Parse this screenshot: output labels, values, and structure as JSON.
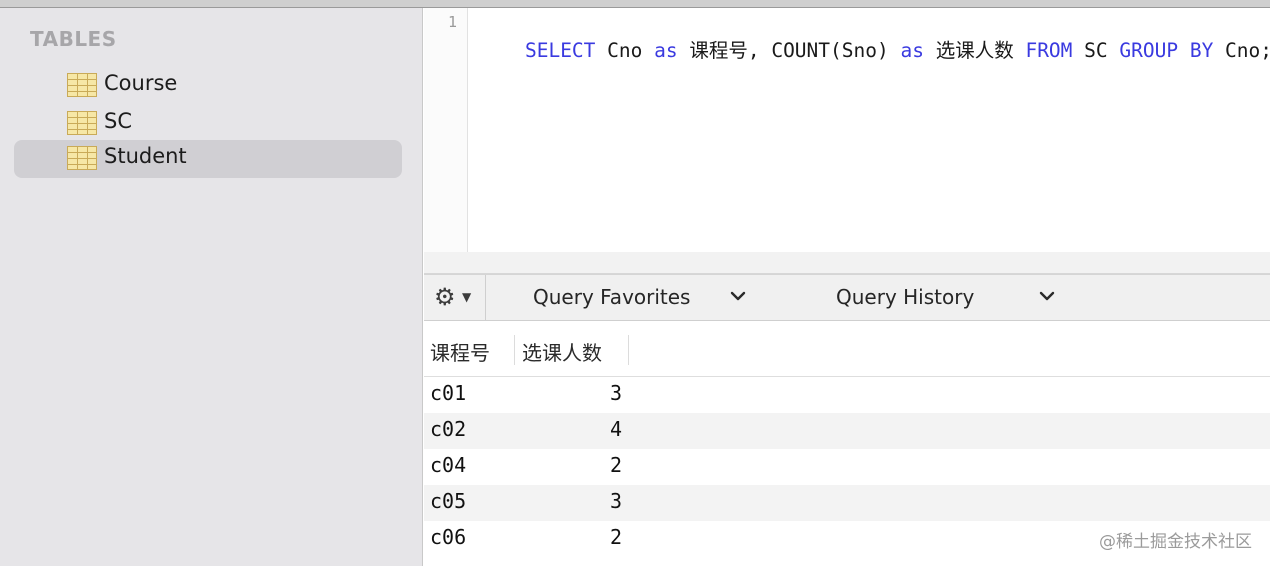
{
  "sidebar": {
    "heading": "TABLES",
    "tables": [
      {
        "label": "Course",
        "selected": false
      },
      {
        "label": "SC",
        "selected": false
      },
      {
        "label": "Student",
        "selected": true
      }
    ]
  },
  "editor": {
    "line_number": "1",
    "query_parts": [
      {
        "text": "SELECT",
        "kind": "keyword"
      },
      {
        "text": " Cno ",
        "kind": "plain"
      },
      {
        "text": "as",
        "kind": "keyword"
      },
      {
        "text": " 课程号, COUNT(Sno) ",
        "kind": "plain"
      },
      {
        "text": "as",
        "kind": "keyword"
      },
      {
        "text": " 选课人数 ",
        "kind": "plain"
      },
      {
        "text": "FROM",
        "kind": "keyword"
      },
      {
        "text": " SC ",
        "kind": "plain"
      },
      {
        "text": "GROUP BY",
        "kind": "keyword"
      },
      {
        "text": " Cno;",
        "kind": "plain"
      }
    ]
  },
  "toolbar": {
    "gear_icon": "gear-icon",
    "favorites_label": "Query Favorites",
    "history_label": "Query History"
  },
  "results": {
    "columns": [
      "课程号",
      "选课人数"
    ],
    "rows": [
      [
        "c01",
        "3"
      ],
      [
        "c02",
        "4"
      ],
      [
        "c04",
        "2"
      ],
      [
        "c05",
        "3"
      ],
      [
        "c06",
        "2"
      ]
    ]
  },
  "watermark": "@稀土掘金技术社区",
  "colors": {
    "keyword": "#3a3ae0",
    "sidebar_bg": "#e6e5e8",
    "selected_bg": "#d0cfd3",
    "row_alt": "#f3f3f3"
  }
}
